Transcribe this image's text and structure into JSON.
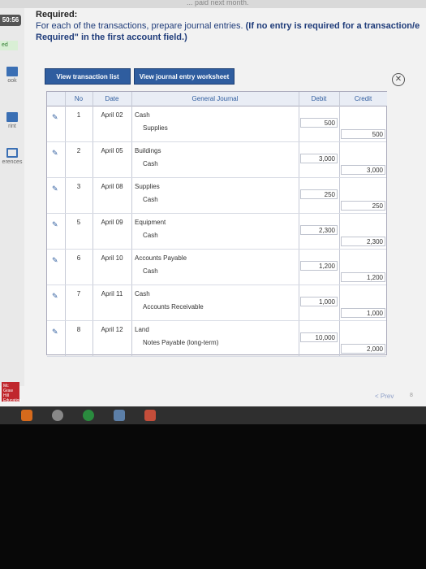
{
  "header": {
    "strip_text": "... paid next month.",
    "timer": "50:56",
    "required_title": "Required:",
    "instruction_plain": "For each of the transactions, prepare journal entries. ",
    "instruction_bold": "(If no entry is required for a transaction/e",
    "instruction_line2": "Required\" in the first account field.)"
  },
  "sidebar": {
    "badge": "ed",
    "items": [
      {
        "label": "ook",
        "icon": "book-icon"
      },
      {
        "label": "rint",
        "icon": "print-icon"
      },
      {
        "label": "erences",
        "icon": "references-icon"
      }
    ]
  },
  "toolbar": {
    "view_list": "View transaction list",
    "view_worksheet": "View journal entry worksheet",
    "close_symbol": "⊗"
  },
  "journal": {
    "headers": {
      "no": "No",
      "date": "Date",
      "general_journal": "General Journal",
      "debit": "Debit",
      "credit": "Credit"
    },
    "rows": [
      {
        "no": "1",
        "date": "April 02",
        "debit_account": "Cash",
        "credit_account": "Supplies",
        "debit": "500",
        "credit": "500"
      },
      {
        "no": "2",
        "date": "April 05",
        "debit_account": "Buildings",
        "credit_account": "Cash",
        "debit": "3,000",
        "credit": "3,000"
      },
      {
        "no": "3",
        "date": "April 08",
        "debit_account": "Supplies",
        "credit_account": "Cash",
        "debit": "250",
        "credit": "250"
      },
      {
        "no": "5",
        "date": "April 09",
        "debit_account": "Equipment",
        "credit_account": "Cash",
        "debit": "2,300",
        "credit": "2,300"
      },
      {
        "no": "6",
        "date": "April 10",
        "debit_account": "Accounts Payable",
        "credit_account": "Cash",
        "debit": "1,200",
        "credit": "1,200"
      },
      {
        "no": "7",
        "date": "April 11",
        "debit_account": "Cash",
        "credit_account": "Accounts Receivable",
        "debit": "1,000",
        "credit": "1,000"
      },
      {
        "no": "8",
        "date": "April 12",
        "debit_account": "Land",
        "credit_account": "Notes Payable (long-term)",
        "debit": "10,000",
        "credit": "2,000"
      }
    ]
  },
  "footer": {
    "prev": "< Prev",
    "page": "8",
    "logo": "Mc Graw Hill Education"
  },
  "colors": {
    "accent": "#2f5d9f",
    "instruction": "#1f3c7a"
  }
}
